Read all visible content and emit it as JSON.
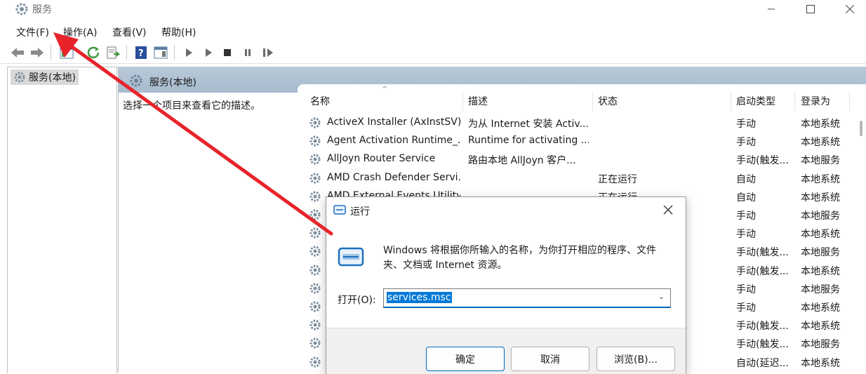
{
  "window": {
    "title": "服务"
  },
  "menu": [
    "文件(F)",
    "操作(A)",
    "查看(V)",
    "帮助(H)"
  ],
  "tree": {
    "root_label": "服务(本地)"
  },
  "panel": {
    "header_title": "服务(本地)",
    "description_prompt": "选择一个项目来查看它的描述。"
  },
  "table": {
    "columns": [
      "名称",
      "描述",
      "状态",
      "启动类型",
      "登录为"
    ],
    "rows": [
      {
        "name": "ActiveX Installer (AxInstSV)",
        "desc": "为从 Internet 安装 Activ...",
        "status": "",
        "startup": "手动",
        "logon": "本地系统"
      },
      {
        "name": "Agent Activation Runtime_...",
        "desc": "Runtime for activating ...",
        "status": "",
        "startup": "手动",
        "logon": "本地系统"
      },
      {
        "name": "AllJoyn Router Service",
        "desc": "路由本地 AllJoyn 客户...",
        "status": "",
        "startup": "手动(触发...",
        "logon": "本地服务"
      },
      {
        "name": "AMD Crash Defender Servi...",
        "desc": "",
        "status": "正在运行",
        "startup": "自动",
        "logon": "本地系统"
      },
      {
        "name": "AMD External Events Utility",
        "desc": "",
        "status": "正在运行",
        "startup": "自动",
        "logon": "本地系统"
      },
      {
        "name": "",
        "desc": "",
        "status": "",
        "startup": "手动",
        "logon": "本地服务"
      },
      {
        "name": "",
        "desc": "",
        "status": "",
        "startup": "手动",
        "logon": "本地系统"
      },
      {
        "name": "",
        "desc": "",
        "status": "",
        "startup": "手动(触发...",
        "logon": "本地服务"
      },
      {
        "name": "",
        "desc": "",
        "status": "",
        "startup": "手动(触发...",
        "logon": "本地系统"
      },
      {
        "name": "",
        "desc": "",
        "status": "",
        "startup": "手动",
        "logon": "本地服务"
      },
      {
        "name": "",
        "desc": "",
        "status": "",
        "startup": "手动",
        "logon": "本地系统"
      },
      {
        "name": "",
        "desc": "",
        "status": "",
        "startup": "手动(触发...",
        "logon": "本地系统"
      },
      {
        "name": "",
        "desc": "",
        "status": "",
        "startup": "手动(触发...",
        "logon": "本地服务"
      },
      {
        "name": "",
        "desc": "",
        "status": "",
        "startup": "自动(延迟...",
        "logon": "本地系统"
      }
    ]
  },
  "run_dialog": {
    "title": "运行",
    "description": "Windows 将根据你所输入的名称，为你打开相应的程序、文件夹、文档或 Internet 资源。",
    "open_label": "打开(O):",
    "input_value": "services.msc",
    "ok_label": "确定",
    "cancel_label": "取消",
    "browse_label": "浏览(B)..."
  },
  "colors": {
    "accent": "#0078d7",
    "arrow": "#e8232a",
    "header_band": "#b0c4d6"
  }
}
